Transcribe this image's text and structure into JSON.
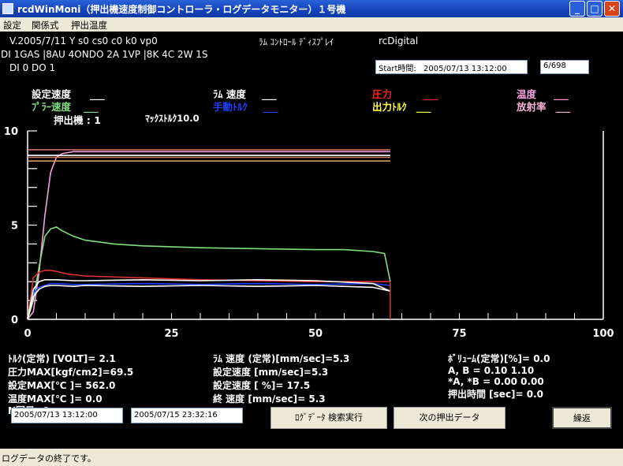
{
  "window": {
    "title": "rcdWinMoni（押出機速度制御コントローラ・ログデータモニター）１号機"
  },
  "menu": [
    "設定",
    "関係式",
    "押出温度"
  ],
  "info": {
    "line1": "V.2005/7/11 Y s0 cs0 c0 k0 vp0",
    "line2": "DI 1GAS |8AU 4ONDO 2A 1VP |8K 4C 2W 1S",
    "line3": "DI 0    DO 1",
    "display_label": "ﾗﾑ ｺﾝﾄﾛｰﾙ ﾃﾞｨｽﾌﾟﾚｲ",
    "mode": "rcDigital",
    "start_time_label": "Start時間:",
    "start_time_value": "2005/07/13 13:12:00",
    "page": "6/698"
  },
  "legend": [
    {
      "label": "設定速度",
      "value": "___",
      "color": "#ffffff"
    },
    {
      "label": "ﾗﾑ 速度",
      "value": "___",
      "color": "#ffffff"
    },
    {
      "label": "圧力",
      "value": "___",
      "color": "#ff2020"
    },
    {
      "label": "温度",
      "value": "___",
      "color": "#f5a0e0"
    },
    {
      "label": "ﾌﾟﾗｰ速度",
      "value": "___",
      "color": "#80e080"
    },
    {
      "label": "手動ﾄﾙｸ",
      "value": "___",
      "color": "#2040ff"
    },
    {
      "label": "出力ﾄﾙｸ",
      "value": "___",
      "color": "#ffff40"
    },
    {
      "label": "放射率",
      "value": "___",
      "color": "#f5b0d8"
    }
  ],
  "extruder": "押出機 : 1",
  "max_torque": "ﾏｯｸｽﾄﾙｸ10.0",
  "chart_data": {
    "type": "line",
    "xlim": [
      0,
      100
    ],
    "ylim": [
      0,
      10
    ],
    "xticks": [
      0,
      25,
      50,
      75,
      100
    ],
    "yticks": [
      0,
      5,
      10
    ],
    "series": [
      {
        "color": "#f5a0e0",
        "x": [
          0,
          1,
          2,
          3,
          4,
          5,
          6,
          7,
          8,
          10,
          12,
          15,
          20,
          30,
          40,
          50,
          60,
          63
        ],
        "y": [
          0,
          0.4,
          2.5,
          5.5,
          7.8,
          8.6,
          8.8,
          8.85,
          8.9,
          8.9,
          8.9,
          8.9,
          8.9,
          8.9,
          8.9,
          8.9,
          8.9,
          8.9
        ]
      },
      {
        "color": "#80e080",
        "x": [
          0,
          1,
          2,
          3,
          4,
          5,
          6,
          8,
          10,
          15,
          20,
          30,
          40,
          50,
          55,
          60,
          62,
          63
        ],
        "y": [
          0,
          1.0,
          2.8,
          4.4,
          4.8,
          4.9,
          4.7,
          4.4,
          4.2,
          4.0,
          3.9,
          3.8,
          3.75,
          3.7,
          3.7,
          3.6,
          3.5,
          2.0
        ]
      },
      {
        "color": "#e03030",
        "x": [
          0,
          1,
          2,
          3,
          4,
          5,
          7,
          10,
          20,
          30,
          40,
          50,
          60,
          63
        ],
        "y": [
          0,
          2.2,
          2.5,
          2.6,
          2.6,
          2.55,
          2.4,
          2.3,
          2.2,
          2.1,
          2.05,
          2.0,
          2.0,
          2.0
        ]
      },
      {
        "color": "#2040ff",
        "x": [
          0,
          1,
          2,
          3,
          4,
          5,
          8,
          10,
          20,
          30,
          40,
          50,
          60,
          63
        ],
        "y": [
          0,
          1.4,
          1.7,
          1.8,
          1.9,
          1.9,
          1.85,
          1.85,
          1.9,
          1.85,
          1.9,
          1.85,
          1.9,
          1.8
        ]
      },
      {
        "color": "#ffffff",
        "x": [
          0,
          1,
          2,
          3,
          4,
          5,
          8,
          10,
          20,
          30,
          40,
          50,
          60,
          63
        ],
        "y": [
          0,
          1.2,
          1.6,
          1.75,
          1.8,
          1.8,
          1.75,
          1.8,
          1.75,
          1.8,
          1.75,
          1.8,
          1.7,
          1.5
        ]
      },
      {
        "color": "#ffffff",
        "x": [
          0,
          1,
          2,
          3,
          4,
          5,
          8,
          10,
          20,
          30,
          40,
          50,
          60,
          63
        ],
        "y": [
          0,
          1.6,
          2.0,
          2.1,
          2.1,
          2.1,
          2.05,
          2.05,
          2.1,
          2.05,
          2.1,
          2.05,
          1.9,
          1.5
        ]
      },
      {
        "color": "#c08060",
        "x": [
          0,
          63
        ],
        "y": [
          8.6,
          8.6
        ]
      },
      {
        "color": "#d0a060",
        "x": [
          0,
          63
        ],
        "y": [
          8.4,
          8.4
        ]
      },
      {
        "color": "#c87060",
        "x": [
          0,
          63
        ],
        "y": [
          9.0,
          9.0
        ]
      },
      {
        "color": "#ffffff",
        "x": [
          0,
          63
        ],
        "y": [
          8.7,
          8.7
        ]
      }
    ]
  },
  "stats": {
    "c1": [
      "ﾄﾙｸ(定常)  [VOLT]= 2.1",
      "圧力MAX[kgf/cm2]=69.5",
      "設定MAX[℃   ]= 562.0",
      "温度MAX[℃   ]= 0.0",
      "N回目=0"
    ],
    "c2": [
      "ﾗﾑ 速度 (定常)[mm/sec]=5.3",
      "設定速度      [mm/sec]=5.3",
      "設定速度         [ %]= 17.5",
      "終  速度       [mm/sec]= 5.3"
    ],
    "c3": [
      "ﾎﾞﾘｭｰﾑ(定常)[%]= 0.0",
      "  A,  B           = 0.10 1.10",
      "  *A,  *B         = 0.00 0.00",
      "押出時間   [sec]= 0.0"
    ]
  },
  "bottom": {
    "date_from": "2005/07/13 13:12:00",
    "date_to": "2005/07/15 23:32:16",
    "search_button": "ﾛｸﾞﾃﾞｰﾀ  検索実行",
    "next_button": "次の押出データ",
    "repeat_button": "繰返"
  },
  "status": "ログデータの終了です。"
}
